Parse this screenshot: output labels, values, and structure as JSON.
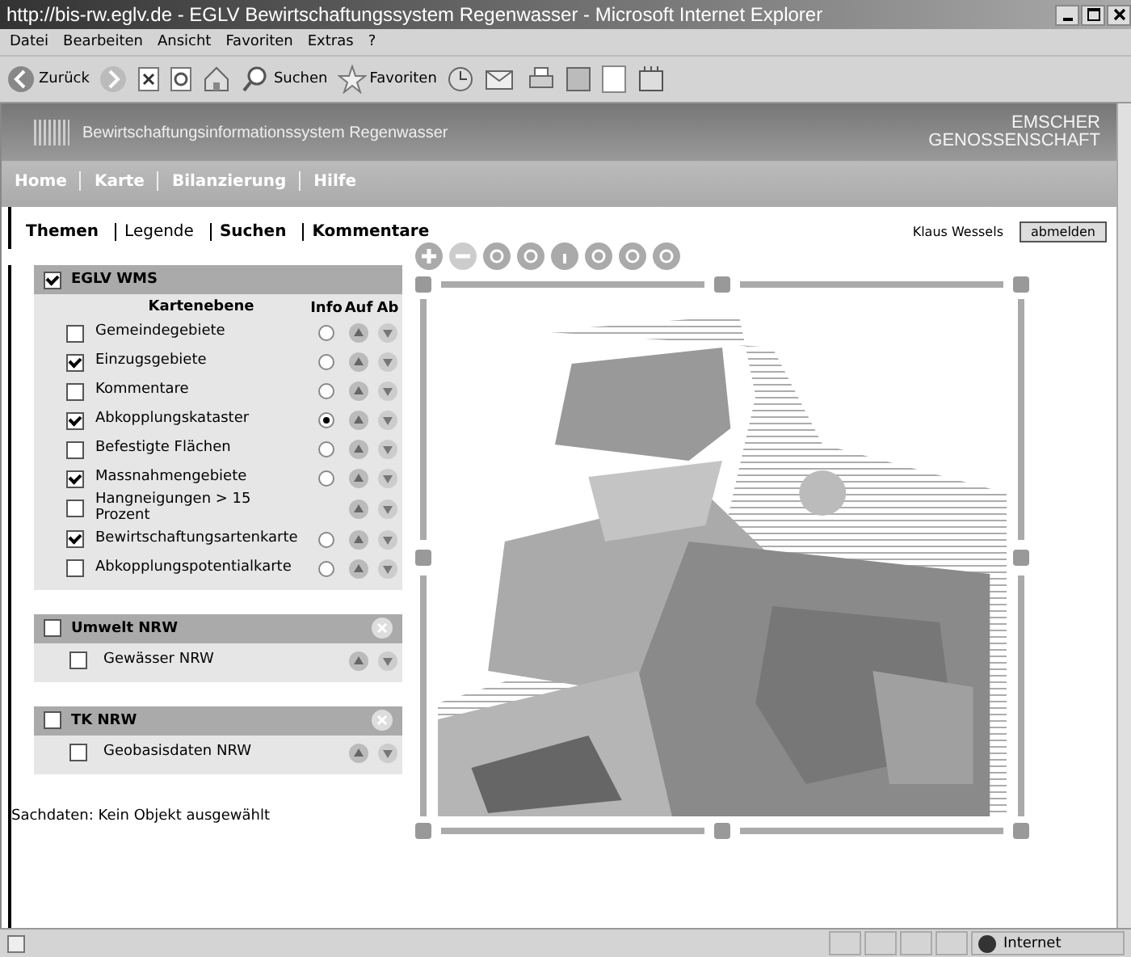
{
  "window": {
    "title": "http://bis-rw.eglv.de - EGLV Bewirtschaftungssystem Regenwasser - Microsoft Internet Explorer"
  },
  "menu": [
    "Datei",
    "Bearbeiten",
    "Ansicht",
    "Favoriten",
    "Extras",
    "?"
  ],
  "toolbar": {
    "back": "Zurück",
    "search": "Suchen",
    "favorites": "Favoriten"
  },
  "banner": {
    "title": "Bewirtschaftungsinformationssystem Regenwasser",
    "logo_top": "EMSCHER",
    "logo_bottom": "GENOSSENSCHAFT"
  },
  "nav": [
    "Home",
    "Karte",
    "Bilanzierung",
    "Hilfe"
  ],
  "tabs": [
    {
      "label": "Themen",
      "bold": true
    },
    {
      "label": "Legende",
      "bold": false
    },
    {
      "label": "Suchen",
      "bold": true
    },
    {
      "label": "Kommentare",
      "bold": true
    }
  ],
  "user": "Klaus Wessels",
  "logout": "abmelden",
  "groups": [
    {
      "title": "EGLV WMS",
      "checked": true,
      "closable": false,
      "columns": [
        "Kartenebene",
        "Info",
        "Auf",
        "Ab"
      ],
      "layers": [
        {
          "label": "Gemeindegebiete",
          "checked": false,
          "info": true,
          "selected": false
        },
        {
          "label": "Einzugsgebiete",
          "checked": true,
          "info": true,
          "selected": false
        },
        {
          "label": "Kommentare",
          "checked": false,
          "info": true,
          "selected": false
        },
        {
          "label": "Abkopplungskataster",
          "checked": true,
          "info": true,
          "selected": true
        },
        {
          "label": "Befestigte Flächen",
          "checked": false,
          "info": true,
          "selected": false
        },
        {
          "label": "Massnahmengebiete",
          "checked": true,
          "info": true,
          "selected": false
        },
        {
          "label": "Hangneigungen > 15 Prozent",
          "checked": false,
          "info": false
        },
        {
          "label": "Bewirtschaftungsartenkarte",
          "checked": true,
          "info": true,
          "selected": false
        },
        {
          "label": "Abkopplungspotentialkarte",
          "checked": false,
          "info": true,
          "selected": false
        }
      ]
    },
    {
      "title": "Umwelt NRW",
      "checked": false,
      "closable": true,
      "layers": [
        {
          "label": "Gewässer NRW",
          "checked": false,
          "info": false
        }
      ]
    },
    {
      "title": "TK NRW",
      "checked": false,
      "closable": true,
      "layers": [
        {
          "label": "Geobasisdaten NRW",
          "checked": false,
          "info": false
        }
      ]
    }
  ],
  "sachdaten": "Sachdaten: Kein Objekt ausgewählt",
  "status_bar": {
    "zone": "Internet"
  }
}
